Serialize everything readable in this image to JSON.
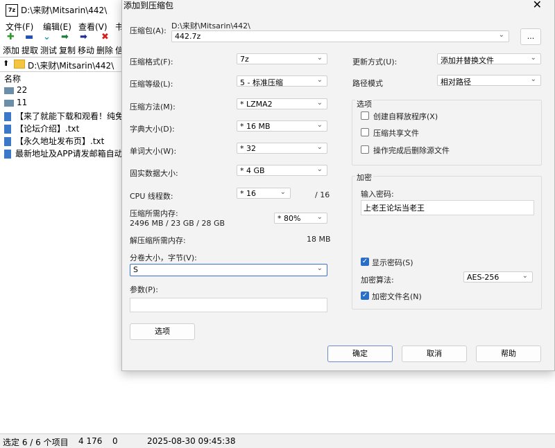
{
  "fm": {
    "window_title": "D:\\来财\\Mitsarin\\442\\",
    "app_icon": "7z",
    "menu": [
      "文件(F)",
      "编辑(E)",
      "查看(V)",
      "书"
    ],
    "toolbar": [
      "添加",
      "提取",
      "测试",
      "复制",
      "移动",
      "删除",
      "信"
    ],
    "address": "D:\\来财\\Mitsarin\\442\\",
    "column_name": "名称",
    "files": [
      {
        "name": "22",
        "type": "folder"
      },
      {
        "name": "11",
        "type": "folder"
      },
      {
        "name": "【来了就能下载和观看！纯免",
        "type": "file"
      },
      {
        "name": "【论坛介绍】.txt",
        "type": "file"
      },
      {
        "name": "【永久地址发布页】.txt",
        "type": "file"
      },
      {
        "name": "最新地址及APP请发邮箱自动",
        "type": "file"
      }
    ],
    "status": {
      "selection": "选定 6 / 6 个项目",
      "size": "4 176",
      "count": "0",
      "date": "2025-08-30 09:45:38"
    }
  },
  "dialog": {
    "title": "添加到压缩包",
    "close": "✕",
    "archive_label": "压缩包(A):",
    "archive_path": "D:\\来财\\Mitsarin\\442\\",
    "archive_name": "442.7z",
    "browse": "...",
    "format_label": "压缩格式(F):",
    "format": "7z",
    "level_label": "压缩等级(L):",
    "level": "5 - 标准压缩",
    "method_label": "压缩方法(M):",
    "method": "*  LZMA2",
    "dict_label": "字典大小(D):",
    "dict": "*  16 MB",
    "word_label": "单词大小(W):",
    "word": "*  32",
    "solid_label": "固实数据大小:",
    "solid": "*  4 GB",
    "threads_label": "CPU 线程数:",
    "threads": "*  16",
    "threads_total": "/ 16",
    "mem_label": "压缩所需内存:",
    "mem_value": "2496 MB / 23 GB / 28 GB",
    "mem_pct": "* 80%",
    "decomp_label": "解压缩所需内存:",
    "decomp_value": "18 MB",
    "split_label": "分卷大小，字节(V):",
    "split_value": "S",
    "params_label": "参数(P):",
    "params_value": "",
    "options_btn": "选项",
    "update_label": "更新方式(U):",
    "update": "添加并替换文件",
    "path_label": "路径模式",
    "path_mode": "相对路径",
    "opts_group": "选项",
    "opt_sfx": "创建自释放程序(X)",
    "opt_shared": "压缩共享文件",
    "opt_delete": "操作完成后删除源文件",
    "enc_group": "加密",
    "pwd_label": "输入密码:",
    "pwd_value": "上老王论坛当老王",
    "show_pwd": "显示密码(S)",
    "enc_method_label": "加密算法:",
    "enc_method": "AES-256",
    "enc_names": "加密文件名(N)",
    "ok": "确定",
    "cancel": "取消",
    "help": "帮助"
  },
  "colors": {
    "accent": "#2a6fc7",
    "primary_border": "#6b8ad1",
    "dialog_bg": "#f3f3f3"
  }
}
